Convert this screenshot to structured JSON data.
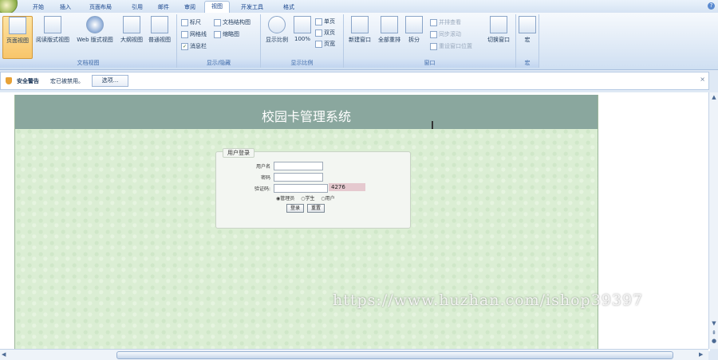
{
  "ribbon": {
    "tabs": [
      "开始",
      "插入",
      "页面布局",
      "引用",
      "邮件",
      "审阅",
      "视图",
      "开发工具",
      "格式"
    ],
    "active_tab": "视图",
    "help": "?",
    "doc_views": {
      "label": "文档视图",
      "buttons": [
        "页面视图",
        "阅读版式视图",
        "Web 版式视图",
        "大纲视图",
        "普通视图"
      ]
    },
    "show_hide": {
      "label": "显示/隐藏",
      "items": [
        {
          "label": "标尺",
          "checked": false
        },
        {
          "label": "文档结构图",
          "checked": false
        },
        {
          "label": "网格线",
          "checked": false
        },
        {
          "label": "缩略图",
          "checked": false
        },
        {
          "label": "消息栏",
          "checked": true
        }
      ]
    },
    "zoom": {
      "label": "显示比例",
      "buttons": [
        "显示比例",
        "100%"
      ],
      "small": [
        "单页",
        "双页",
        "页宽"
      ]
    },
    "window": {
      "label": "窗口",
      "buttons": [
        "新建窗口",
        "全部重排",
        "拆分"
      ],
      "disabled": [
        "并排查看",
        "同步滚动",
        "重设窗口位置"
      ],
      "switch": "切换窗口"
    },
    "macro": {
      "label": "宏",
      "button": "宏"
    }
  },
  "security": {
    "title": "安全警告",
    "message": "宏已被禁用。",
    "options": "选项..."
  },
  "page": {
    "banner_title": "校园卡管理系统",
    "login": {
      "legend": "用户登录",
      "username_label": "用户名",
      "password_label": "密码",
      "captcha_label": "验证码:",
      "captcha_text": "4276",
      "roles": [
        "管理员",
        "学生",
        "用户"
      ],
      "login_button": "登录",
      "reset_button": "重置"
    }
  },
  "watermark": "https://www.huzhan.com/ishop39397"
}
